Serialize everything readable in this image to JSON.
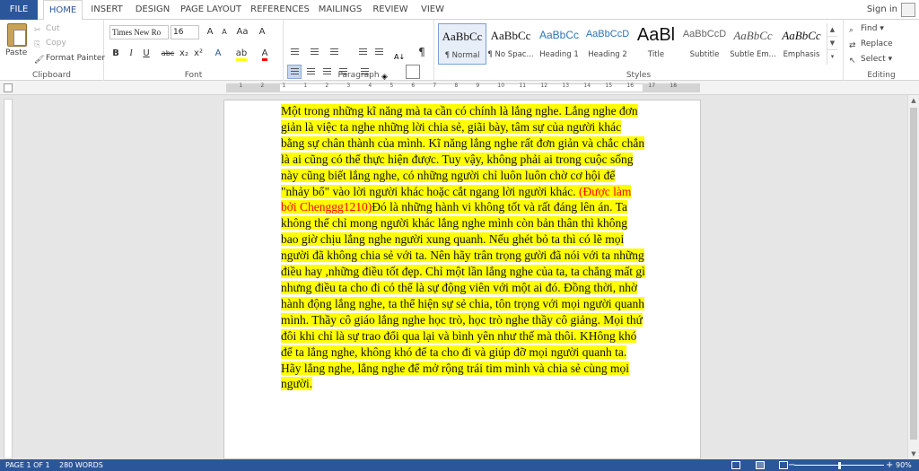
{
  "tabs": [
    "FILE",
    "HOME",
    "INSERT",
    "DESIGN",
    "PAGE LAYOUT",
    "REFERENCES",
    "MAILINGS",
    "REVIEW",
    "VIEW"
  ],
  "signin": "Sign in",
  "clipboard": {
    "paste": "Paste",
    "cut": "Cut",
    "copy": "Copy",
    "format_painter": "Format Painter",
    "label": "Clipboard"
  },
  "font": {
    "name": "Times New Ro",
    "size": "16",
    "label": "Font",
    "bold": "B",
    "italic": "I",
    "underline": "U",
    "strike": "abc",
    "sub": "x₂",
    "sup": "x²",
    "grow": "A",
    "shrink": "A",
    "case": "Aa",
    "clear": "A"
  },
  "paragraph": {
    "label": "Paragraph",
    "pilcrow": "¶"
  },
  "styles": {
    "label": "Styles",
    "items": [
      {
        "sample": "AaBbCc",
        "name": "¶ Normal"
      },
      {
        "sample": "AaBbCc",
        "name": "¶ No Spac..."
      },
      {
        "sample": "AaBbCc",
        "name": "Heading 1"
      },
      {
        "sample": "AaBbCcD",
        "name": "Heading 2"
      },
      {
        "sample": "AaBl",
        "name": "Title"
      },
      {
        "sample": "AaBbCcD",
        "name": "Subtitle"
      },
      {
        "sample": "AaBbCc",
        "name": "Subtle Em..."
      },
      {
        "sample": "AaBbCc",
        "name": "Emphasis"
      }
    ]
  },
  "editing": {
    "find": "Find",
    "replace": "Replace",
    "select": "Select",
    "label": "Editing"
  },
  "ruler_numbers": [
    "1",
    "2",
    "1",
    "1",
    "2",
    "3",
    "4",
    "5",
    "6",
    "7",
    "8",
    "9",
    "10",
    "11",
    "12",
    "13",
    "14",
    "15",
    "16",
    "17",
    "18"
  ],
  "document": {
    "text_before": "Một trong những kĩ năng mà ta cần có chính là lắng nghe. Lắng nghe đơn giản là việc ta nghe những lời chia sẻ, giãi bày, tâm sự của người khác bằng sự chân thành của mình. Kĩ năng lắng nghe rất đơn giản và chắc chắn là ai cũng có thể thực hiện được. Tuy vậy, không phải ai trong cuộc sống này cũng biết lắng nghe, có những người chỉ luôn luôn chờ cơ hội để \"nhảy bổ\" vào lời người khác hoặc cắt ngang lời người khác. ",
    "red_text": "(Được làm bởi Chenggg1210)",
    "text_after": "Đó là những hành vi không tốt và rất đáng lên án. Ta không thể chỉ mong người khác lắng nghe mình còn bản thân thì không bao giờ chịu lắng nghe người xung quanh. Nếu ghét bỏ ta thì có lẽ mọi người đã không chia sẻ với ta. Nên hãy trân trọng gười đã nói với ta những điều hay ,những điều tốt đẹp. Chỉ một lần lắng nghe của ta, ta chẳng mất gì nhưng điều ta cho đi có thể là sự động viên với một ai đó. Đồng thời, nhờ hành động lắng nghe, ta thể hiện sự sẻ chia, tôn trọng với mọi người quanh mình. Thầy cô giáo lắng nghe học trò, học trò nghe thầy cô giảng. Mọi thứ đôi khi chỉ là sự trao đổi qua lại và bình yên như thế mà thôi. KHông khó để ta lắng nghe, không khó để ta cho đi và giúp đỡ mọi người quanh ta. Hãy lắng nghe, lắng nghe để mở rộng trái tim mình và chia sẻ cùng mọi người."
  },
  "status": {
    "page": "PAGE 1 OF 1",
    "words": "280 WORDS",
    "zoom": "90%",
    "minus": "−",
    "plus": "+"
  },
  "colors": {
    "accent": "#2b579a",
    "highlight": "#ffff00",
    "red_text": "#ff0000"
  }
}
